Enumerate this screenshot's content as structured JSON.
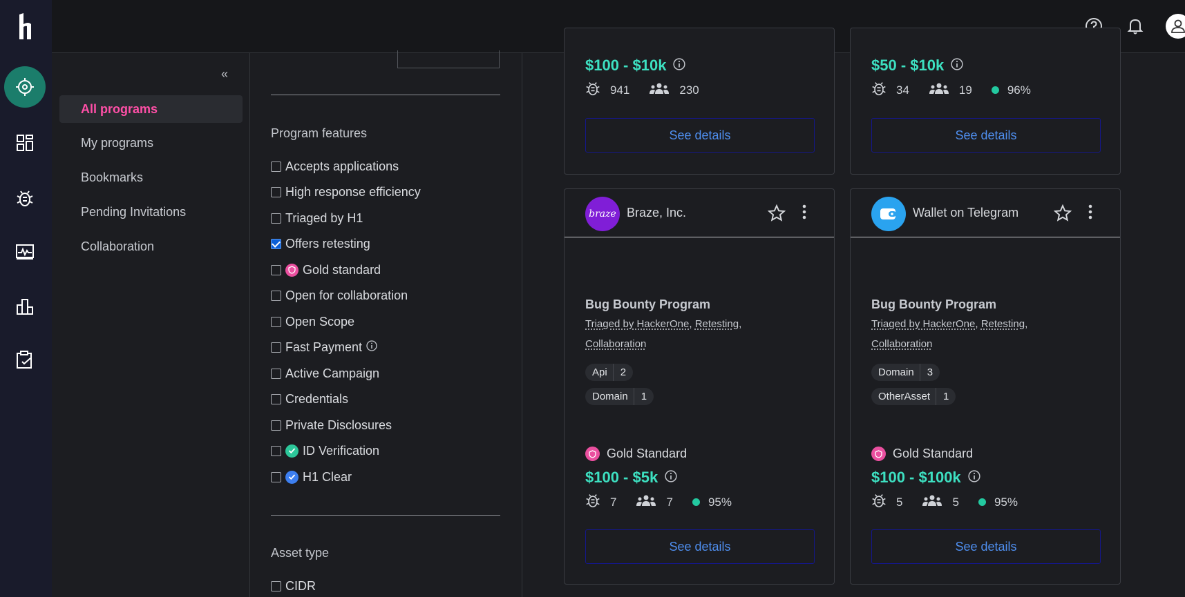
{
  "subnav": {
    "items": [
      {
        "label": "All programs"
      },
      {
        "label": "My programs"
      },
      {
        "label": "Bookmarks"
      },
      {
        "label": "Pending Invitations"
      },
      {
        "label": "Collaboration"
      }
    ]
  },
  "filters": {
    "features_title": "Program features",
    "features": [
      {
        "label": "Accepts applications",
        "checked": false
      },
      {
        "label": "High response efficiency",
        "checked": false
      },
      {
        "label": "Triaged by H1",
        "checked": false
      },
      {
        "label": "Offers retesting",
        "checked": true
      },
      {
        "label": "Gold standard",
        "checked": false
      },
      {
        "label": "Open for collaboration",
        "checked": false
      },
      {
        "label": "Open Scope",
        "checked": false
      },
      {
        "label": "Fast Payment",
        "checked": false
      },
      {
        "label": "Active Campaign",
        "checked": false
      },
      {
        "label": "Credentials",
        "checked": false
      },
      {
        "label": "Private Disclosures",
        "checked": false
      },
      {
        "label": "ID Verification",
        "checked": false
      },
      {
        "label": "H1 Clear",
        "checked": false
      }
    ],
    "asset_title": "Asset type",
    "assets": [
      {
        "label": "CIDR",
        "checked": false
      }
    ]
  },
  "cards_top": [
    {
      "bounty": "$100 - $10k",
      "reports": "941",
      "hackers": "230",
      "efficiency": "",
      "button": "See details"
    },
    {
      "bounty": "$50 - $10k",
      "reports": "34",
      "hackers": "19",
      "efficiency": "96%",
      "button": "See details"
    }
  ],
  "cards": [
    {
      "name": "Braze, Inc.",
      "logo_text": "braze",
      "logo_color": "#801ed7",
      "type": "Bug Bounty Program",
      "link1": "Triaged by HackerOne",
      "link2": "Retesting",
      "link3": "Collaboration",
      "chips": [
        {
          "label": "Api",
          "count": "2"
        },
        {
          "label": "Domain",
          "count": "1"
        }
      ],
      "gold": "Gold Standard",
      "bounty": "$100 - $5k",
      "reports": "7",
      "hackers": "7",
      "efficiency": "95%",
      "button": "See details"
    },
    {
      "name": "Wallet on Telegram",
      "logo_text": "",
      "logo_color": "#2aa3ef",
      "type": "Bug Bounty Program",
      "link1": "Triaged by HackerOne",
      "link2": "Retesting",
      "link3": "Collaboration",
      "chips": [
        {
          "label": "Domain",
          "count": "3"
        },
        {
          "label": "OtherAsset",
          "count": "1"
        }
      ],
      "gold": "Gold Standard",
      "bounty": "$100 - $100k",
      "reports": "5",
      "hackers": "5",
      "efficiency": "95%",
      "button": "See details"
    }
  ],
  "colors": {
    "accent": "#ff4fa7",
    "bounty": "#3de0c1",
    "rail": "#191b2b",
    "active_rail": "#1b7d6b"
  }
}
